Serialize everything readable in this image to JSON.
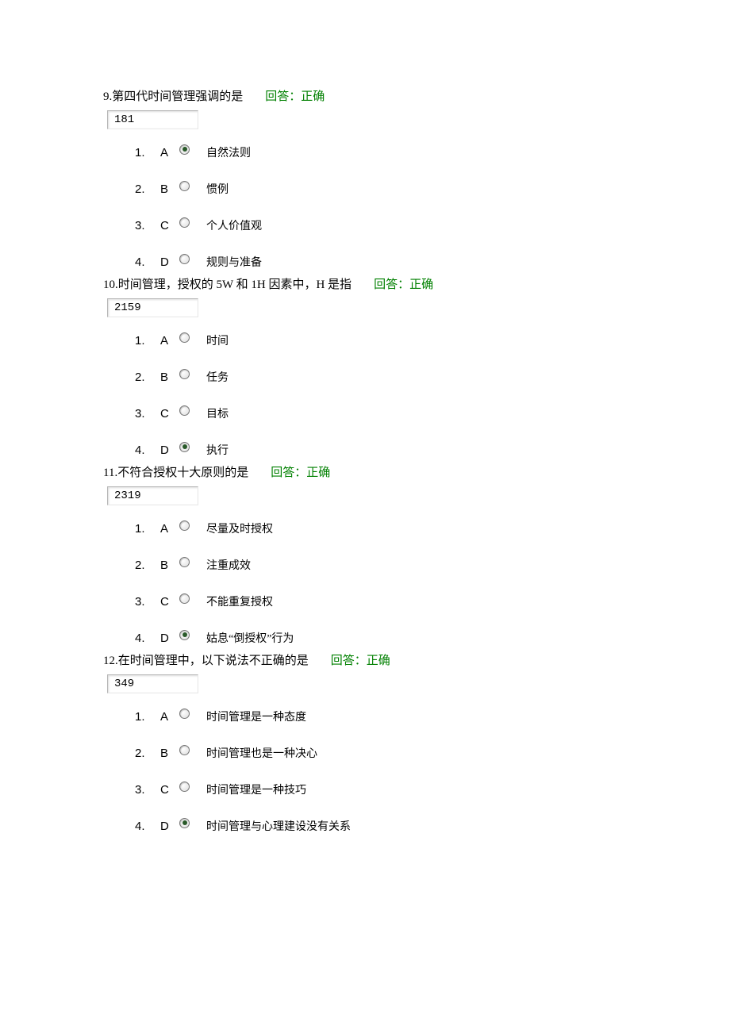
{
  "questions": [
    {
      "num": "9.",
      "text": "第四代时间管理强调的是",
      "answer_label": "回答：正确",
      "code": "181",
      "options": [
        {
          "n": "1.",
          "l": "A",
          "t": "自然法则",
          "selected": true
        },
        {
          "n": "2.",
          "l": "B",
          "t": "惯例",
          "selected": false
        },
        {
          "n": "3.",
          "l": "C",
          "t": "个人价值观",
          "selected": false
        },
        {
          "n": "4.",
          "l": "D",
          "t": "规则与准备",
          "selected": false
        }
      ]
    },
    {
      "num": "10.",
      "text": "时间管理，授权的 5W 和 1H 因素中，H 是指",
      "answer_label": "回答：正确",
      "code": "2159",
      "options": [
        {
          "n": "1.",
          "l": "A",
          "t": "时间",
          "selected": false
        },
        {
          "n": "2.",
          "l": "B",
          "t": "任务",
          "selected": false
        },
        {
          "n": "3.",
          "l": "C",
          "t": "目标",
          "selected": false
        },
        {
          "n": "4.",
          "l": "D",
          "t": "执行",
          "selected": true
        }
      ]
    },
    {
      "num": "11.",
      "text": "不符合授权十大原则的是",
      "answer_label": "回答：正确",
      "code": "2319",
      "options": [
        {
          "n": "1.",
          "l": "A",
          "t": "尽量及时授权",
          "selected": false
        },
        {
          "n": "2.",
          "l": "B",
          "t": "注重成效",
          "selected": false
        },
        {
          "n": "3.",
          "l": "C",
          "t": "不能重复授权",
          "selected": false
        },
        {
          "n": "4.",
          "l": "D",
          "t": "姑息“倒授权”行为",
          "selected": true
        }
      ]
    },
    {
      "num": "12.",
      "text": "在时间管理中，以下说法不正确的是",
      "answer_label": "回答：正确",
      "code": "349",
      "options": [
        {
          "n": "1.",
          "l": "A",
          "t": "时间管理是一种态度",
          "selected": false
        },
        {
          "n": "2.",
          "l": "B",
          "t": "时间管理也是一种决心",
          "selected": false
        },
        {
          "n": "3.",
          "l": "C",
          "t": "时间管理是一种技巧",
          "selected": false
        },
        {
          "n": "4.",
          "l": "D",
          "t": "时间管理与心理建设没有关系",
          "selected": true
        }
      ]
    }
  ]
}
